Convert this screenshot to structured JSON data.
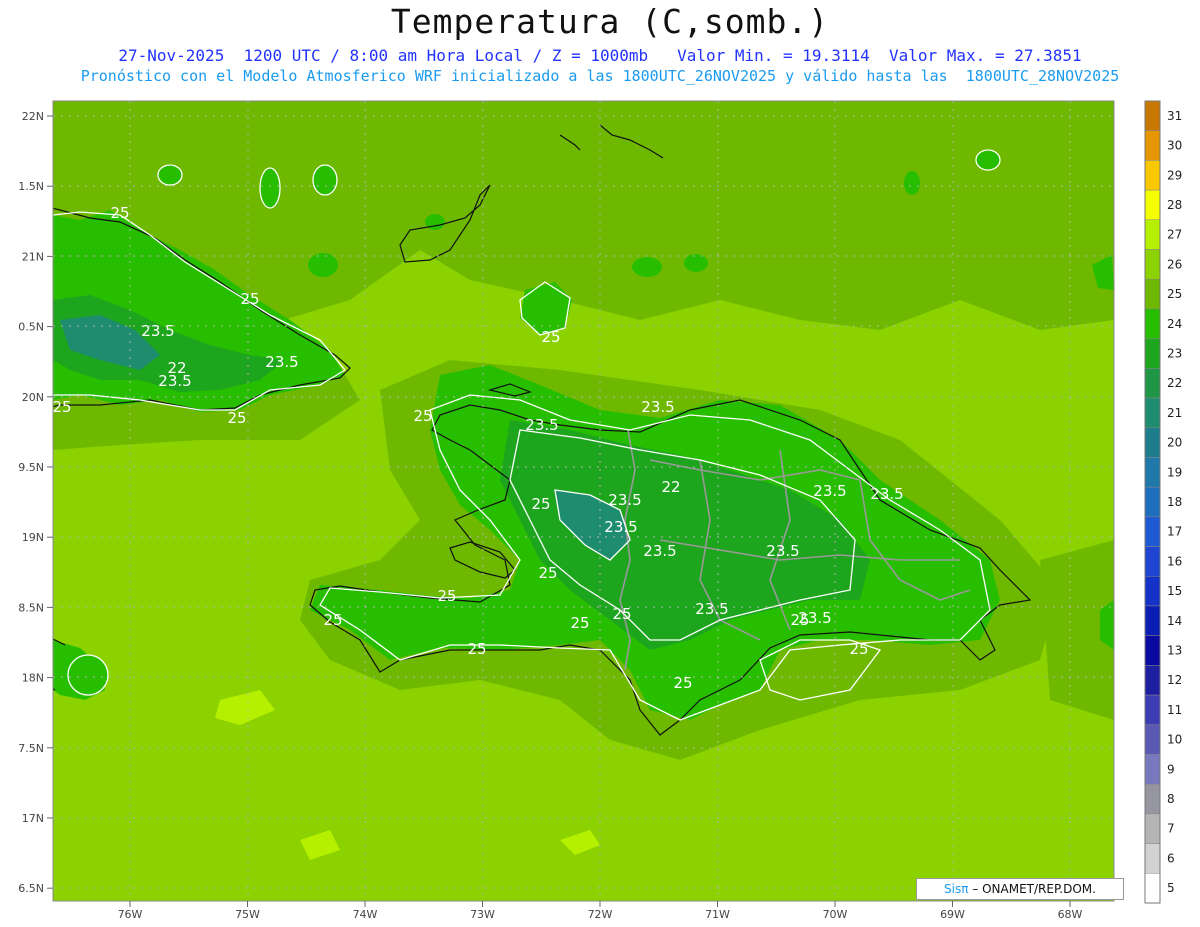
{
  "header": {
    "title": "Temperatura (C,somb.)",
    "subtitle_1": "27-Nov-2025  1200 UTC / 8:00 am Hora Local / Z = 1000mb   Valor Min. = 19.3114  Valor Max. = 27.3851",
    "subtitle_2": "Pronóstico con el Modelo Atmosferico WRF inicializado a las 1800UTC_26NOV2025 y válido hasta las  1800UTC_28NOV2025"
  },
  "axes": {
    "lat_labels": [
      "22N",
      "1.5N",
      "21N",
      "0.5N",
      "20N",
      "9.5N",
      "19N",
      "8.5N",
      "18N",
      "7.5N",
      "17N",
      "6.5N"
    ],
    "lon_labels": [
      "76W",
      "75W",
      "74W",
      "73W",
      "72W",
      "71W",
      "70W",
      "69W",
      "68W"
    ]
  },
  "colorbar": {
    "levels": [
      {
        "label": "31",
        "color": "#c87800"
      },
      {
        "label": "30",
        "color": "#e69600"
      },
      {
        "label": "29",
        "color": "#fac800"
      },
      {
        "label": "28",
        "color": "#f5ff00"
      },
      {
        "label": "27",
        "color": "#b4f000"
      },
      {
        "label": "26",
        "color": "#8cd200"
      },
      {
        "label": "25",
        "color": "#6eb900"
      },
      {
        "label": "24",
        "color": "#28be00"
      },
      {
        "label": "23",
        "color": "#1ea51e"
      },
      {
        "label": "22",
        "color": "#1e9646"
      },
      {
        "label": "21",
        "color": "#1e8c6e"
      },
      {
        "label": "20",
        "color": "#1e7d8c"
      },
      {
        "label": "19",
        "color": "#1e78aa"
      },
      {
        "label": "18",
        "color": "#1e6ebe"
      },
      {
        "label": "17",
        "color": "#1e5ad2"
      },
      {
        "label": "16",
        "color": "#1e46d2"
      },
      {
        "label": "15",
        "color": "#1432c8"
      },
      {
        "label": "14",
        "color": "#0a1eb4"
      },
      {
        "label": "13",
        "color": "#0a0aa0"
      },
      {
        "label": "12",
        "color": "#1e1ea0"
      },
      {
        "label": "11",
        "color": "#3c3cb4"
      },
      {
        "label": "10",
        "color": "#5a5ab4"
      },
      {
        "label": "9",
        "color": "#7878be"
      },
      {
        "label": "8",
        "color": "#9696a0"
      },
      {
        "label": "7",
        "color": "#b4b4b4"
      },
      {
        "label": "6",
        "color": "#d2d2d2"
      },
      {
        "label": "5",
        "color": "#ffffff"
      }
    ]
  },
  "contour_labels": [
    "25",
    "25",
    "25",
    "23.5",
    "22",
    "23.5",
    "23.5",
    "25",
    "25",
    "25",
    "23.5",
    "23.5",
    "23.5",
    "23.5",
    "22",
    "23.5",
    "23.5",
    "25",
    "23.5",
    "23.5",
    "25",
    "25",
    "25",
    "25",
    "25",
    "25",
    "23.5",
    "25",
    "23.5",
    "25",
    "25"
  ],
  "map_colors": {
    "sea": "#8cd200",
    "shelf": "#6eb900",
    "land_main": "#28be00",
    "land_highland": "#1ea51e",
    "land_peak": "#1e8c6e",
    "warm_patch": "#b4f000",
    "coast": "#111111",
    "border": "#999999",
    "contour": "#ffffff"
  },
  "credit": {
    "sis": "Sisπ",
    "rest": " – ONAMET/REP.DOM."
  }
}
